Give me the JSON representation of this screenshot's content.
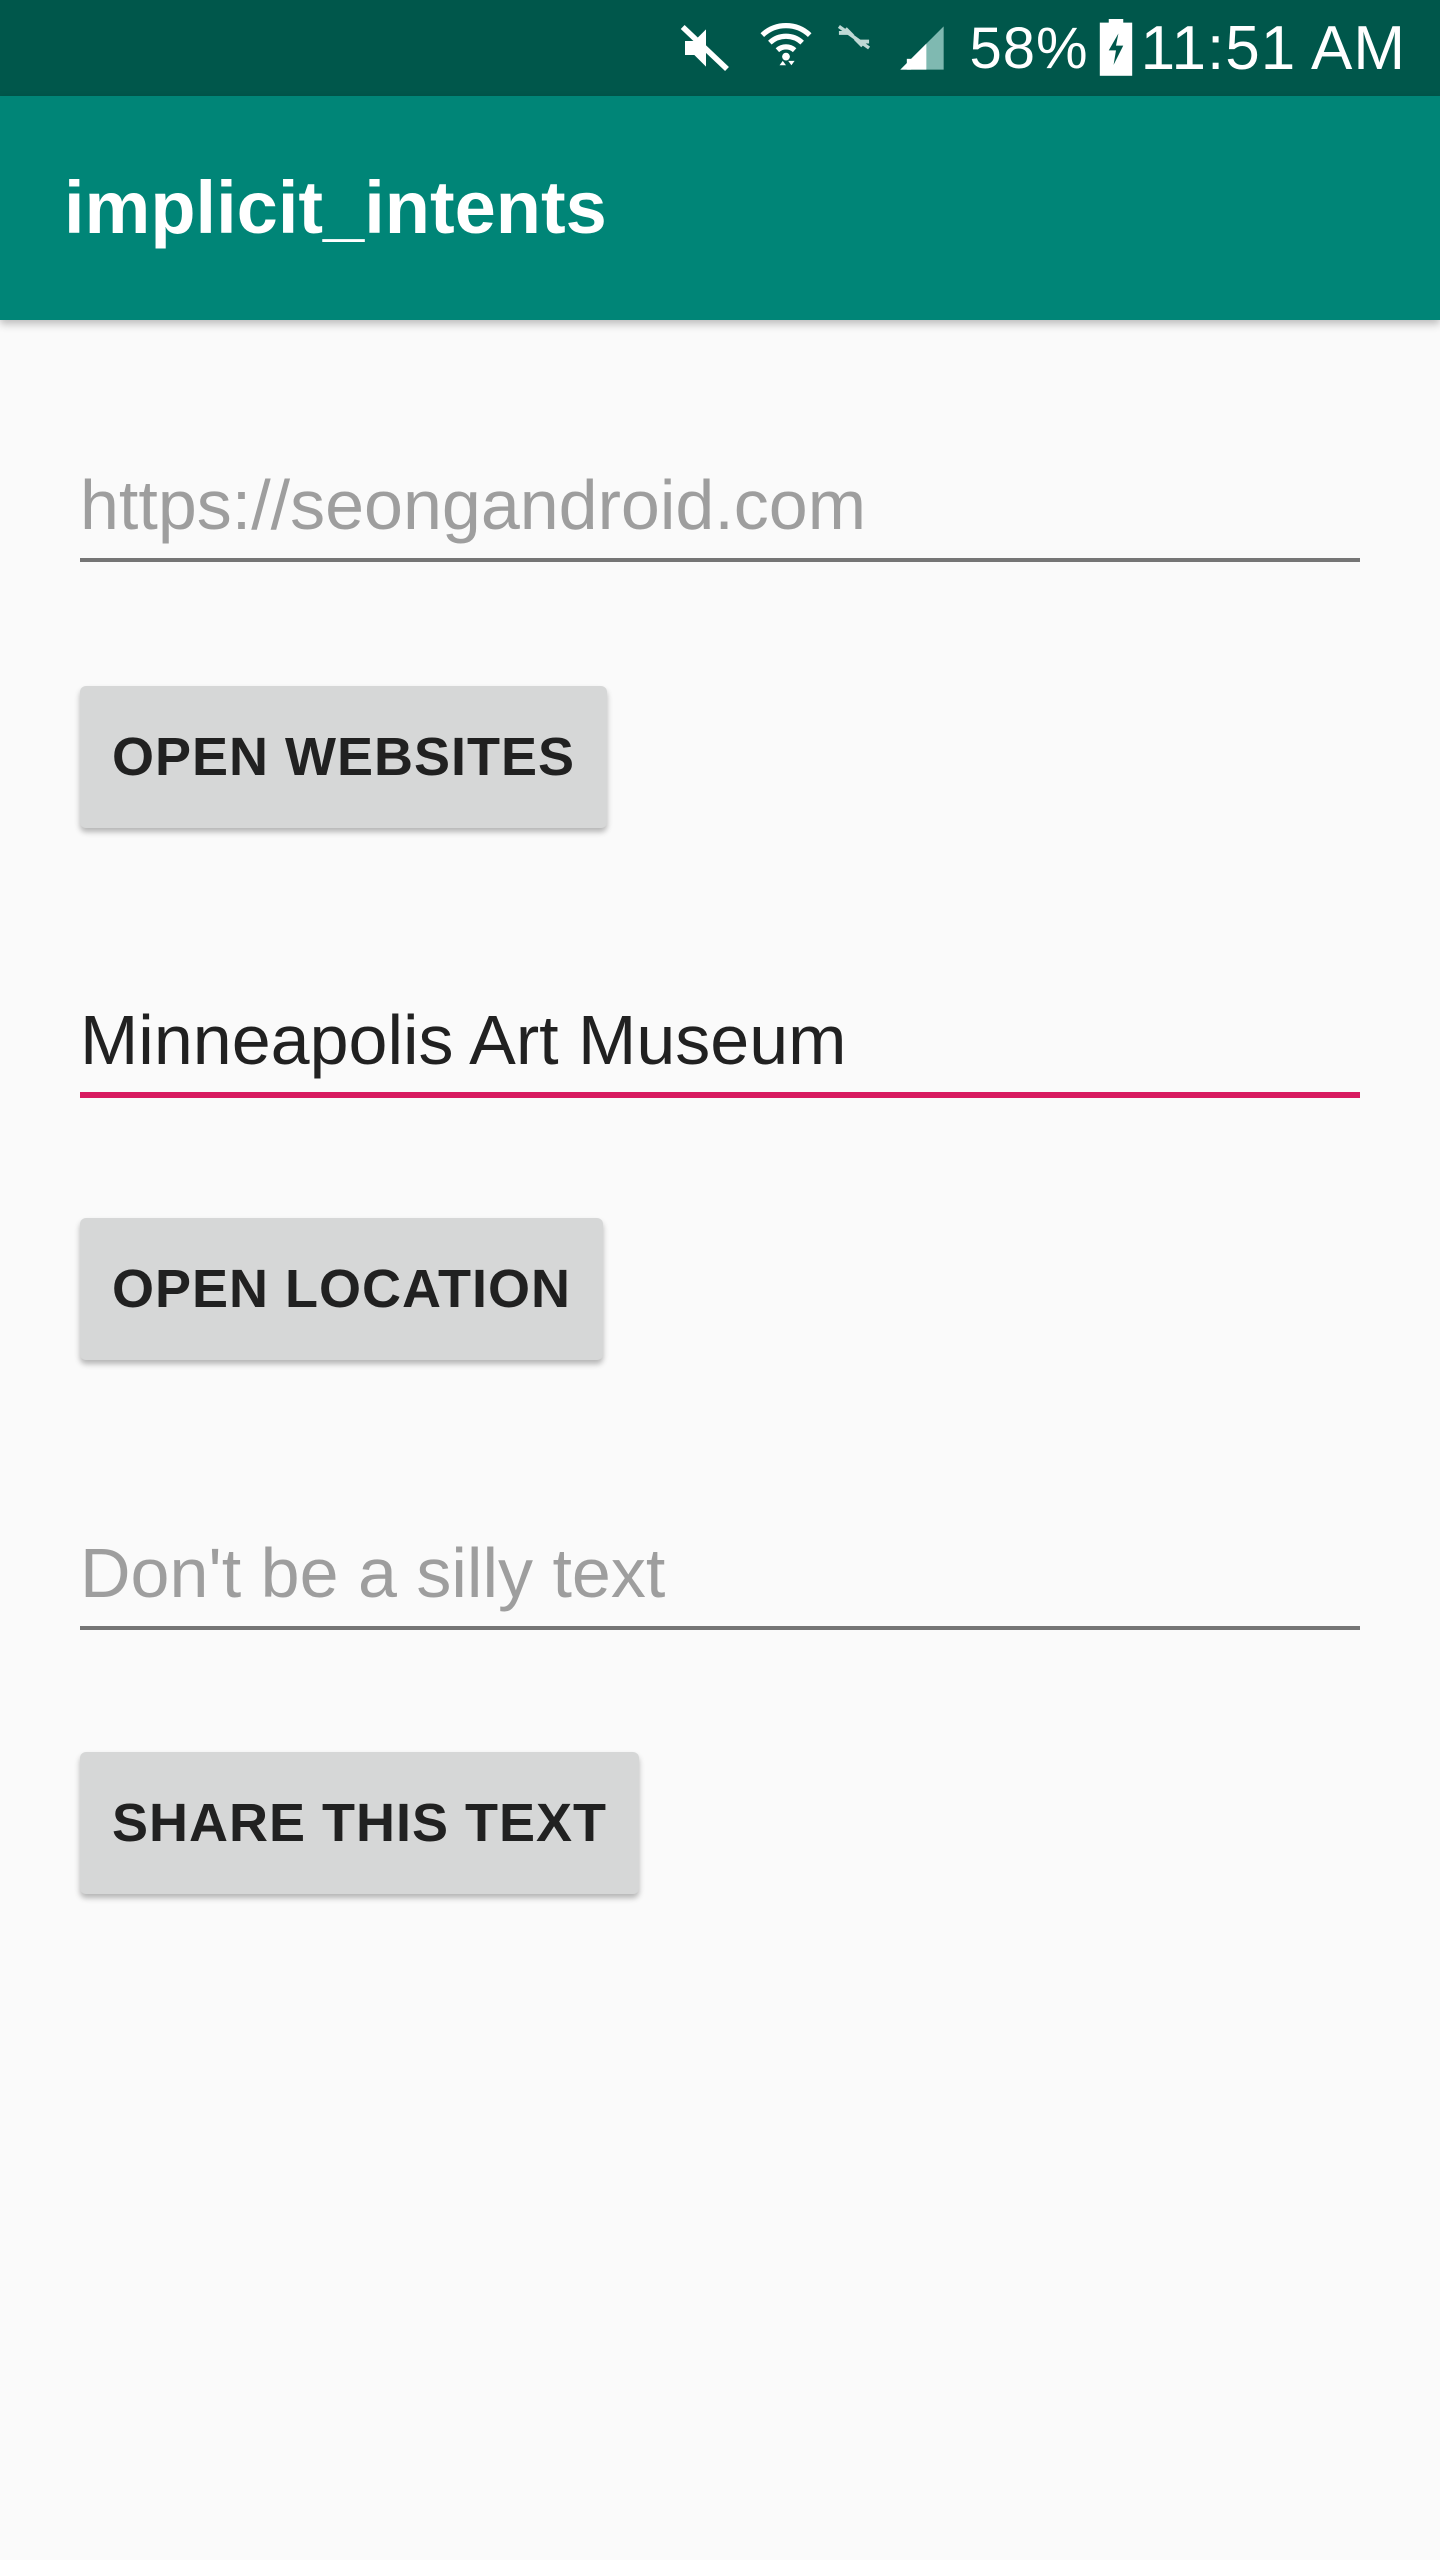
{
  "status_bar": {
    "icons": [
      "mute-icon",
      "wifi-icon",
      "data-off-icon",
      "signal-icon",
      "battery-charging-icon"
    ],
    "battery": "58%",
    "time": "11:51 AM"
  },
  "app_bar": {
    "title": "implicit_intents"
  },
  "website": {
    "placeholder": "https://seongandroid.com",
    "value": "",
    "button_label": "OPEN WEBSITES"
  },
  "location": {
    "placeholder": "",
    "value": "Minneapolis Art Museum",
    "button_label": "OPEN LOCATION"
  },
  "share": {
    "placeholder": "Don't be a silly text",
    "value": "",
    "button_label": "SHARE THIS TEXT"
  },
  "colors": {
    "status_bar": "#00574b",
    "app_bar": "#008577",
    "accent": "#d81b60",
    "button": "#d6d7d7",
    "background": "#fafafa"
  }
}
